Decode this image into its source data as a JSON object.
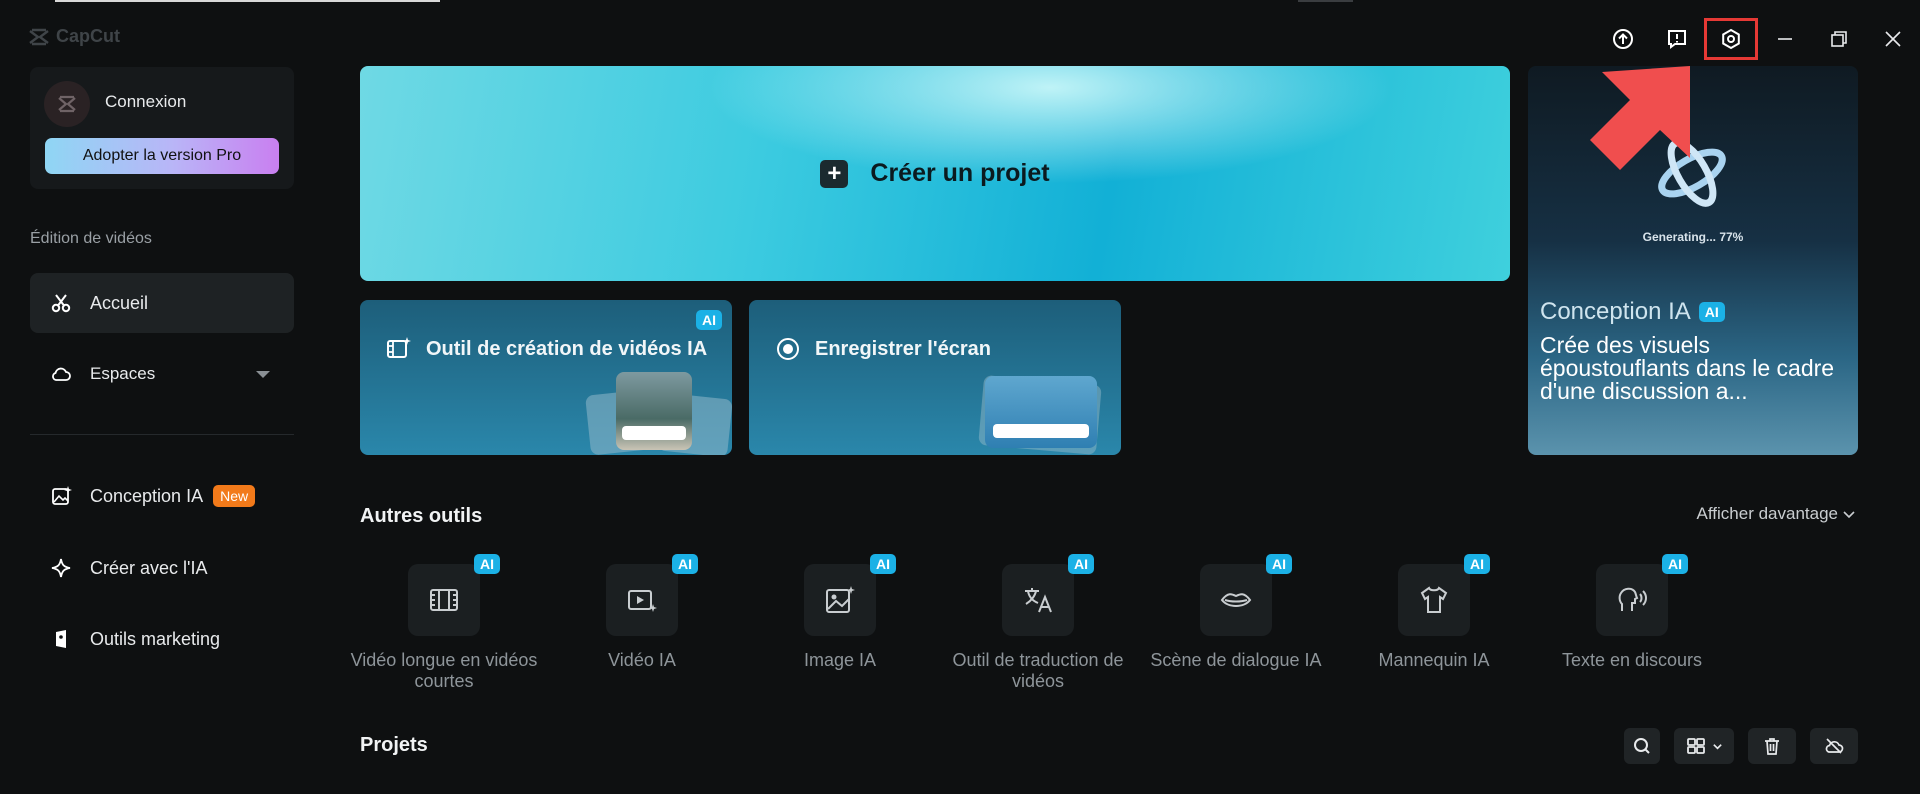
{
  "app": {
    "name": "CapCut"
  },
  "window_controls": [
    {
      "name": "upload-icon"
    },
    {
      "name": "feedback-icon"
    },
    {
      "name": "settings-icon"
    },
    {
      "name": "minimize-icon"
    },
    {
      "name": "restore-icon"
    },
    {
      "name": "close-icon"
    }
  ],
  "account": {
    "name": "Connexion",
    "pro_button": "Adopter la version Pro"
  },
  "sidebar": {
    "section_title": "Édition de vidéos",
    "home": "Accueil",
    "spaces": "Espaces",
    "ai_design": "Conception IA",
    "ai_design_badge": "New",
    "create_ai": "Créer avec l'IA",
    "marketing": "Outils marketing"
  },
  "hero": {
    "label": "Créer un projet"
  },
  "cards": {
    "ai_video_tool": "Outil de création de vidéos IA",
    "ai_badge": "AI",
    "record_screen": "Enregistrer l'écran"
  },
  "side_card": {
    "status": "Generating... 77%",
    "progress_percent": 77,
    "title": "Conception IA",
    "badge": "AI",
    "description": "Crée des visuels époustouflants dans le cadre d'une discussion a..."
  },
  "tools": {
    "title": "Autres outils",
    "more": "Afficher davantage",
    "items": [
      {
        "label": "Vidéo longue en vidéos courtes",
        "badge": "AI",
        "icon": "long-to-short-icon"
      },
      {
        "label": "Vidéo IA",
        "badge": "AI",
        "icon": "ai-video-icon"
      },
      {
        "label": "Image IA",
        "badge": "AI",
        "icon": "ai-image-icon"
      },
      {
        "label": "Outil de traduction de vidéos",
        "badge": "AI",
        "icon": "translate-icon"
      },
      {
        "label": "Scène de dialogue IA",
        "badge": "AI",
        "icon": "lips-icon"
      },
      {
        "label": "Mannequin IA",
        "badge": "AI",
        "icon": "shirt-icon"
      },
      {
        "label": "Texte en discours",
        "badge": "AI",
        "icon": "speech-icon"
      }
    ]
  },
  "projects": {
    "title": "Projets"
  },
  "colors": {
    "accent_cyan": "#1bb1e6",
    "new_badge": "#f27a1a",
    "highlight": "#e53935"
  }
}
